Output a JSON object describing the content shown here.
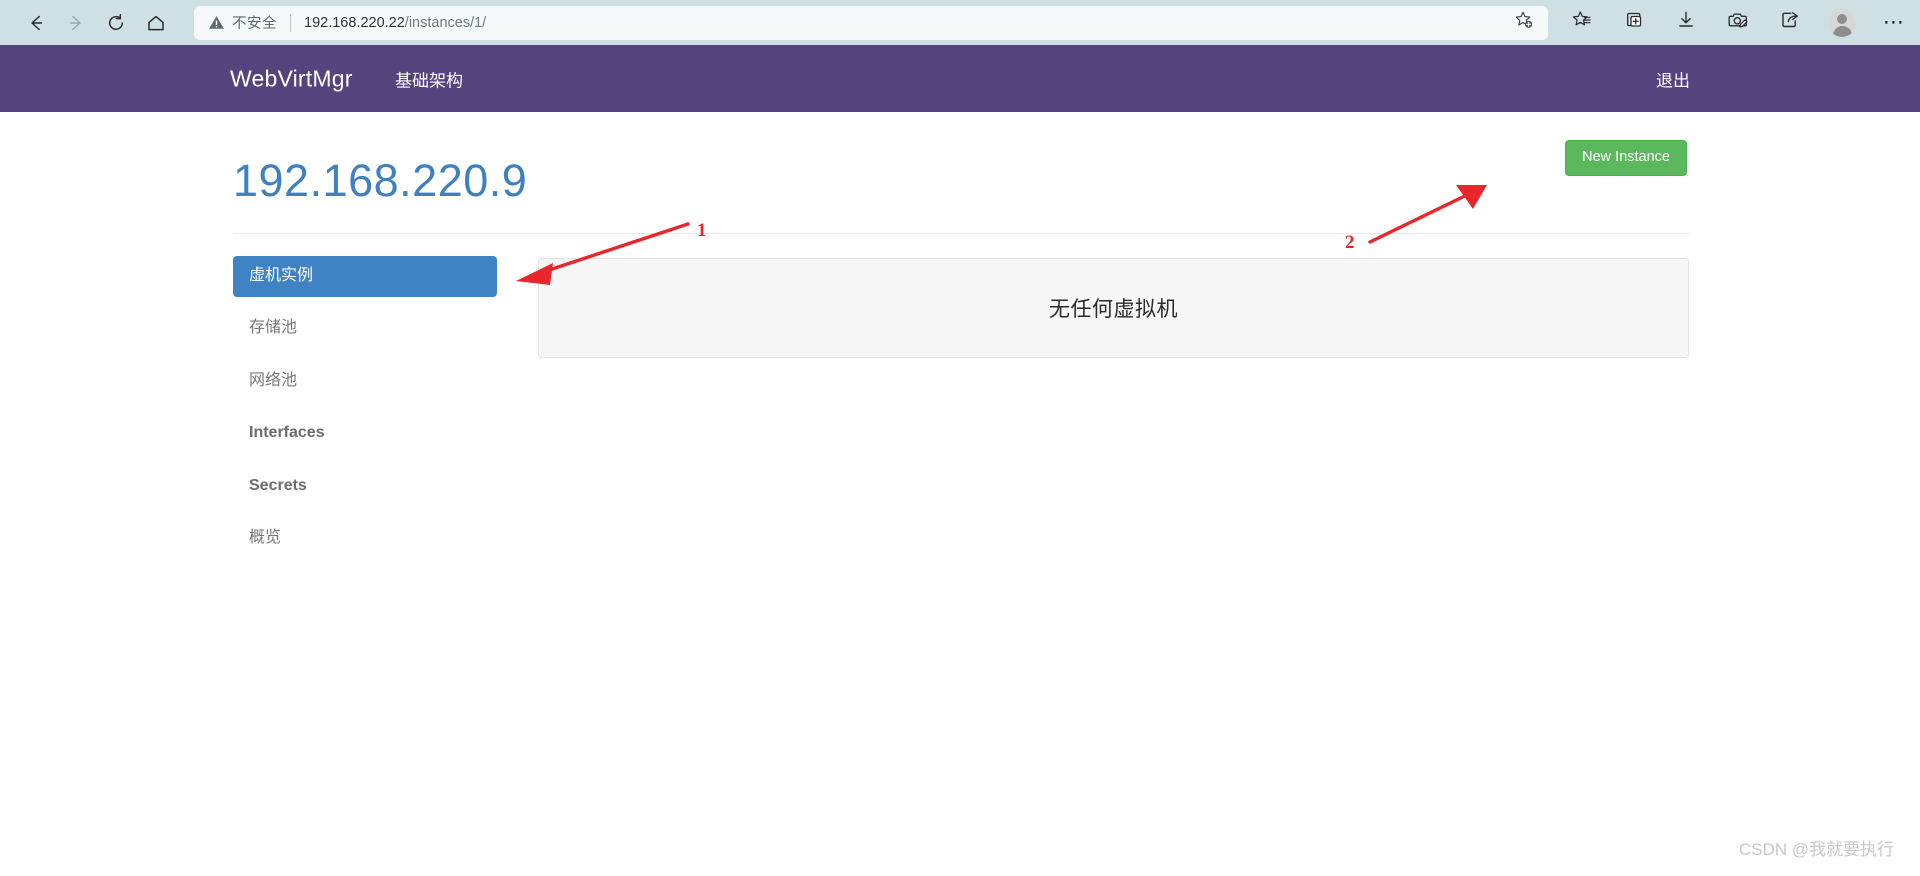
{
  "browser": {
    "back_icon": "back-arrow-icon",
    "forward_icon": "forward-arrow-icon",
    "reload_icon": "reload-icon",
    "home_icon": "home-icon",
    "security_label": "不安全",
    "url_host": "192.168.220.22",
    "url_path": "/instances/1/",
    "url_full": "192.168.220.22/instances/1/",
    "add_favorite_icon": "star-plus-icon",
    "favorites_icon": "star-list-icon",
    "collections_icon": "collections-plus-icon",
    "downloads_icon": "download-arrow-icon",
    "screenshot_icon": "camera-pencil-icon",
    "share_icon": "share-icon",
    "profile_icon": "profile-avatar-icon",
    "settings_icon": "more-dots-icon"
  },
  "navbar": {
    "brand": "WebVirtMgr",
    "infrastructure_label": "基础架构",
    "logout_label": "退出"
  },
  "page": {
    "title": "192.168.220.9",
    "new_instance_label": "New Instance"
  },
  "sidebar": {
    "items": [
      {
        "label": "虚机实例",
        "active": true,
        "latin": false
      },
      {
        "label": "存储池",
        "active": false,
        "latin": false
      },
      {
        "label": "网络池",
        "active": false,
        "latin": false
      },
      {
        "label": "Interfaces",
        "active": false,
        "latin": true
      },
      {
        "label": "Secrets",
        "active": false,
        "latin": true
      },
      {
        "label": "概览",
        "active": false,
        "latin": false
      }
    ]
  },
  "main": {
    "empty_message": "无任何虚拟机"
  },
  "annotations": {
    "markers": [
      {
        "id": "1",
        "label": "1",
        "target": "虚机实例"
      },
      {
        "id": "2",
        "label": "2",
        "target": "New Instance"
      }
    ],
    "color": "#e8262b"
  },
  "watermark": {
    "text": "CSDN @我就要执行"
  },
  "colors": {
    "browser_toolbar": "#cfe0e5",
    "navbar_purple": "#54437d",
    "title_blue": "#3f80c0",
    "active_item_blue": "#4083c4",
    "button_green": "#5cb85c",
    "panel_gray": "#f7f7f7",
    "annotation_red": "#e8262b"
  }
}
